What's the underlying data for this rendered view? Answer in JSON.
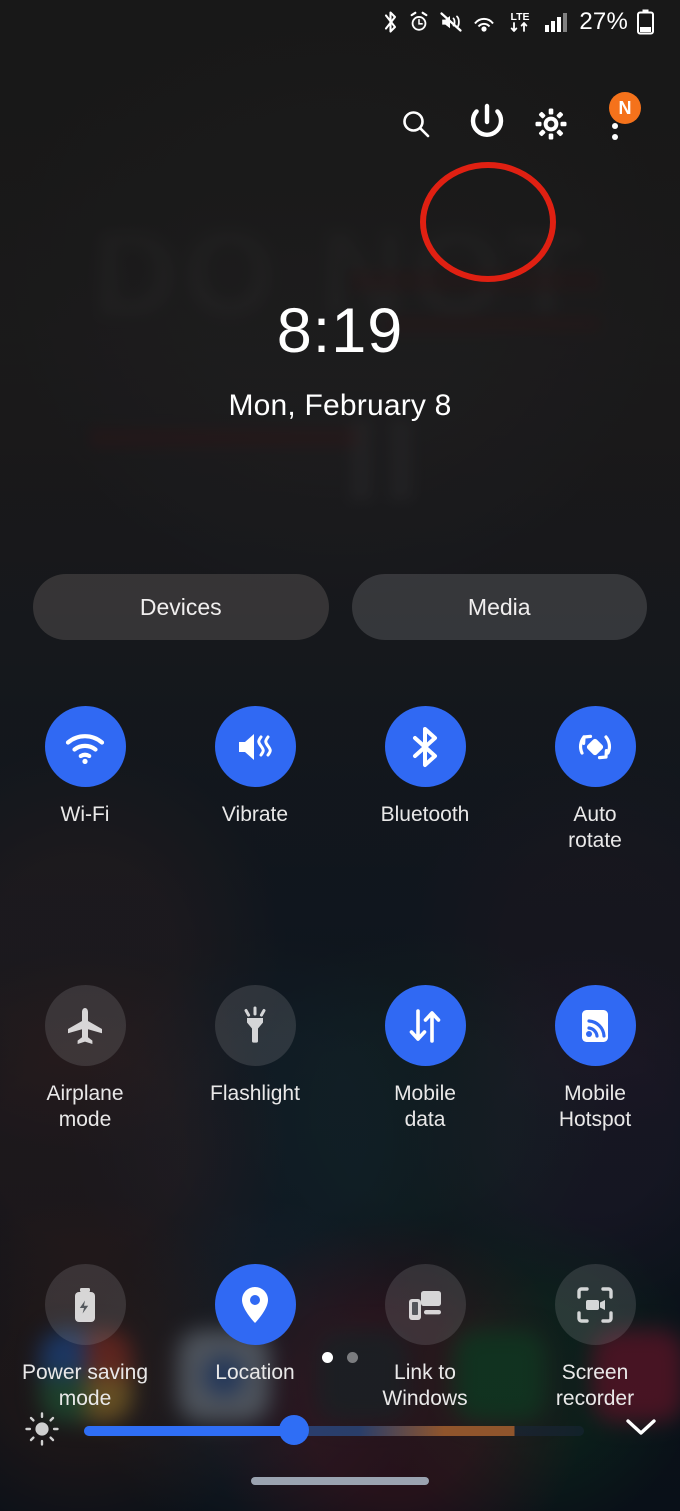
{
  "status_bar": {
    "icons": [
      "bluetooth-icon",
      "alarm-icon",
      "mute-vibrate-icon",
      "wifi-calling-icon"
    ],
    "network_type": "LTE",
    "signal": "signal-bars-icon",
    "battery_percent": "27%",
    "battery_icon": "battery-low-icon"
  },
  "header": {
    "search_label": "search-icon",
    "power_label": "power-icon",
    "settings_label": "gear-icon",
    "more_label": "kebab-menu-icon",
    "notification_badge": "N",
    "annotation": "red-highlight-circle"
  },
  "lock_screen": {
    "time": "8:19",
    "date": "Mon, February 8",
    "wallpaper_text": "DO NOT"
  },
  "pills": {
    "devices": "Devices",
    "media": "Media"
  },
  "tiles": [
    {
      "label": "Wi-Fi",
      "icon": "wifi-icon",
      "state": "on"
    },
    {
      "label": "Vibrate",
      "icon": "vibrate-icon",
      "state": "on"
    },
    {
      "label": "Bluetooth",
      "icon": "bluetooth-icon",
      "state": "on"
    },
    {
      "label": "Auto\nrotate",
      "icon": "auto-rotate-icon",
      "state": "on"
    },
    {
      "label": "Airplane\nmode",
      "icon": "airplane-icon",
      "state": "off"
    },
    {
      "label": "Flashlight",
      "icon": "flashlight-icon",
      "state": "off"
    },
    {
      "label": "Mobile\ndata",
      "icon": "mobile-data-icon",
      "state": "on"
    },
    {
      "label": "Mobile\nHotspot",
      "icon": "hotspot-icon",
      "state": "on"
    },
    {
      "label": "Power saving\nmode",
      "icon": "battery-saver-icon",
      "state": "off"
    },
    {
      "label": "Location",
      "icon": "location-pin-icon",
      "state": "on"
    },
    {
      "label": "Link to\nWindows",
      "icon": "link-to-windows-icon",
      "state": "off"
    },
    {
      "label": "Screen\nrecorder",
      "icon": "screen-recorder-icon",
      "state": "off"
    }
  ],
  "pagination": {
    "pages": 2,
    "active": 1
  },
  "brightness": {
    "icon": "brightness-sun-icon",
    "value_percent": 42,
    "expand_icon": "chevron-down-icon"
  },
  "nav_bar": {
    "home_indicator": "home-gesture-bar"
  },
  "colors": {
    "accent_blue": "#3069f3",
    "annotation_red": "#e02012",
    "badge_orange": "#f5721b",
    "tile_off": "rgba(150,152,155,0.22)"
  }
}
